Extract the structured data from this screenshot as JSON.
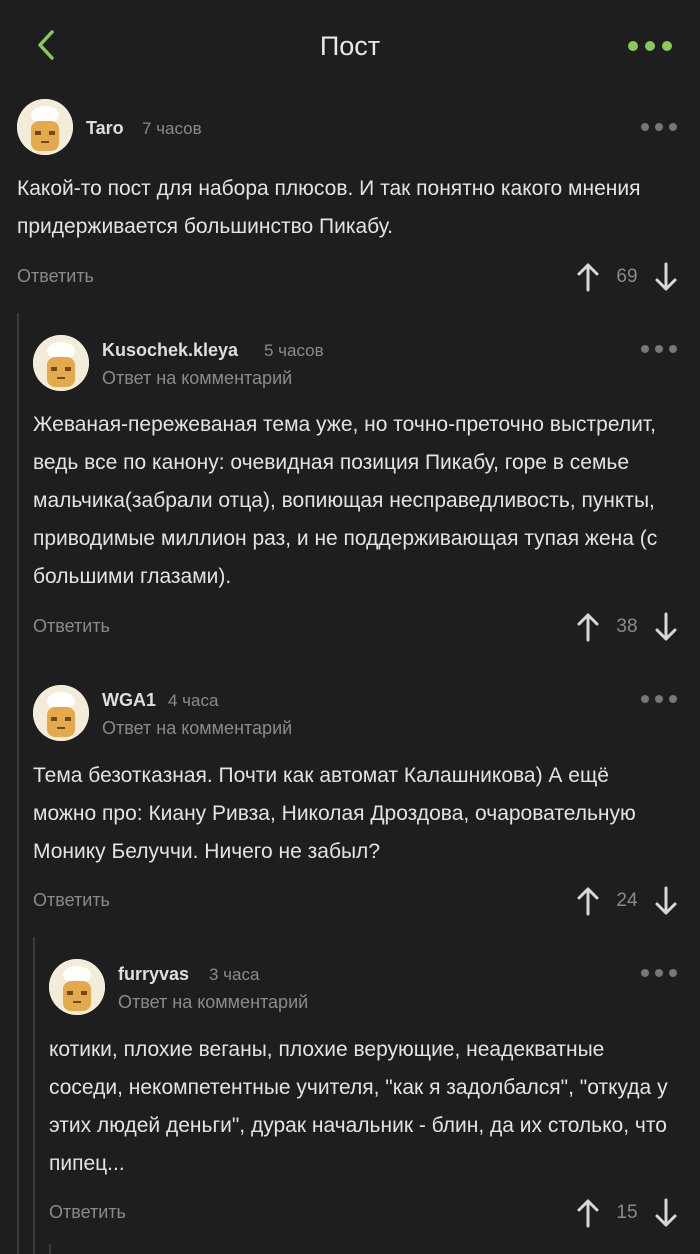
{
  "header": {
    "title": "Пост",
    "back_icon": "chevron-left-icon",
    "menu_icon": "more-horizontal-icon",
    "accent_color": "#8ac858"
  },
  "comments": [
    {
      "author": "Taro",
      "time": "7 часов",
      "reply_to": "",
      "text": "Какой-то пост для набора плюсов. И так понятно какого мнения придерживается большинство Пикабу.",
      "reply_label": "Ответить",
      "score": "69"
    },
    {
      "author": "Kusochek.kleya",
      "time": "5 часов",
      "reply_to": "Ответ на комментарий",
      "text": "Жеваная-пережеваная тема уже, но точно-преточно выстрелит, ведь все по канону: очевидная позиция Пикабу, горе в семье мальчика(забрали отца), вопиющая несправедливость, пункты, приводимые миллион раз, и не поддерживающая тупая жена (с большими глазами).",
      "reply_label": "Ответить",
      "score": "38"
    },
    {
      "author": "WGA1",
      "time": "4 часа",
      "reply_to": "Ответ на комментарий",
      "text": "Тема безотказная. Почти как автомат Калашникова) А ещё можно про: Киану Ривза, Николая Дроздова, очаровательную Монику Белуччи. Ничего не забыл?",
      "reply_label": "Ответить",
      "score": "24"
    },
    {
      "author": "furryvas",
      "time": "3 часа",
      "reply_to": "Ответ на комментарий",
      "text": "котики, плохие веганы, плохие верующие, неадекватные соседи, некомпетентные учителя, \"как я задолбался\", \"откуда у этих людей деньги\", дурак начальник - блин, да их столько, что пипец...",
      "reply_label": "Ответить",
      "score": "15"
    }
  ]
}
